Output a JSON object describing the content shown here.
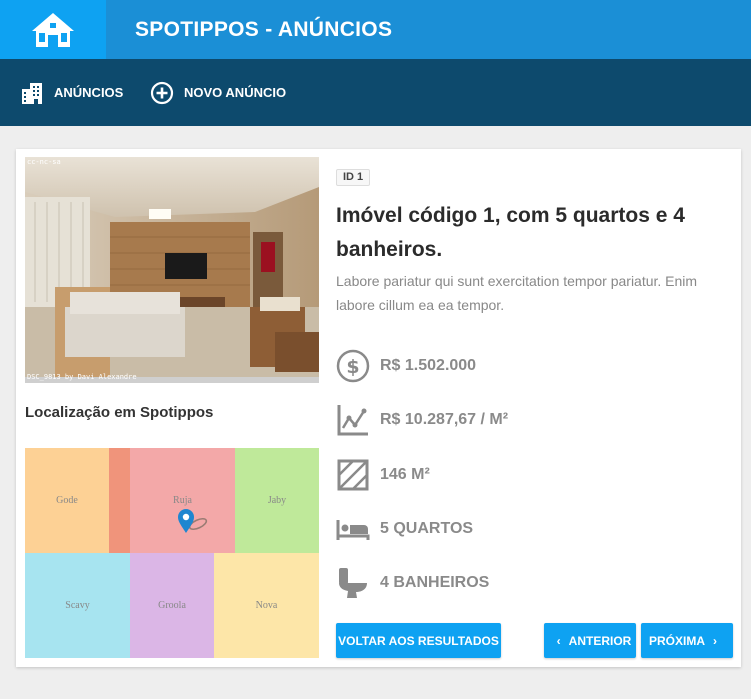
{
  "header": {
    "title": "SPOTIPPOS - ANÚNCIOS",
    "logo_icon": "house-logo-icon"
  },
  "nav": {
    "items": [
      {
        "label": "ANÚNCIOS",
        "icon": "buildings-icon"
      },
      {
        "label": "NOVO ANÚNCIO",
        "icon": "plus-circle-icon"
      }
    ]
  },
  "listing": {
    "photo_badge": "cc-nc-sa",
    "photo_caption": "DSC_9813 by Davi Alexandre",
    "id_badge": "ID 1",
    "title": "Imóvel código 1, com 5 quartos e 4 banheiros.",
    "description": "Labore pariatur qui sunt exercitation tempor pariatur. Enim labore cillum ea ea tempor.",
    "features": [
      {
        "icon": "dollar-icon",
        "text": "R$ 1.502.000"
      },
      {
        "icon": "chart-line-icon",
        "text": "R$ 10.287,67 / M²"
      },
      {
        "icon": "area-square-icon",
        "text": "146 M²"
      },
      {
        "icon": "bed-icon",
        "text": "5 QUARTOS"
      },
      {
        "icon": "toilet-icon",
        "text": "4 BANHEIROS"
      }
    ]
  },
  "location": {
    "title": "Localização em Spotippos",
    "regions": [
      {
        "name": "Gode",
        "color": "#fdd195"
      },
      {
        "name": "Ruja",
        "color": "#f3a8a8"
      },
      {
        "name": "Jaby",
        "color": "#bfe99a"
      },
      {
        "name": "Scavy",
        "color": "#a7e4f0"
      },
      {
        "name": "Groola",
        "color": "#dbb6e6"
      },
      {
        "name": "Nova",
        "color": "#fde6a8"
      }
    ],
    "overlap_color": "#f0947b",
    "pin_color": "#1f86d0"
  },
  "actions": {
    "back": "VOLTAR AOS RESULTADOS",
    "previous": "ANTERIOR",
    "next": "PRÓXIMA"
  },
  "colors": {
    "primary": "#0ea2f2",
    "header": "#1b8fd6",
    "nav": "#0d4a6d"
  }
}
